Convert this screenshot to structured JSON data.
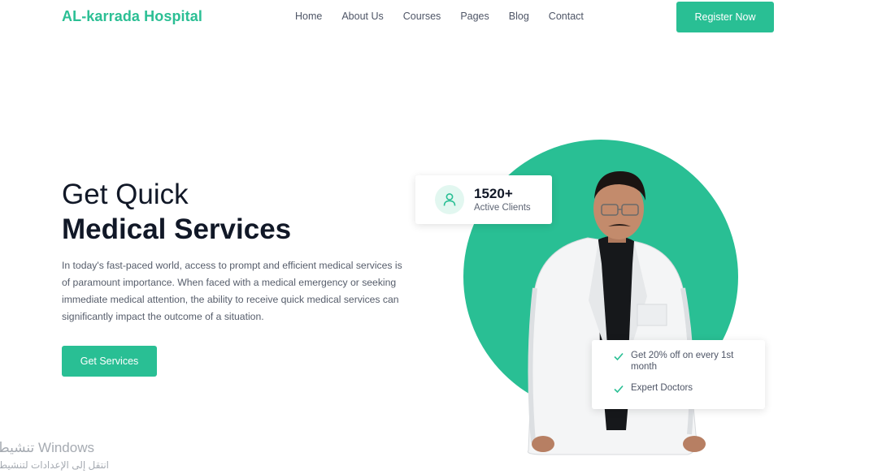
{
  "header": {
    "brand": "AL-karrada Hospital",
    "nav": [
      "Home",
      "About Us",
      "Courses",
      "Pages",
      "Blog",
      "Contact"
    ],
    "register_label": "Register Now"
  },
  "hero": {
    "title_line1": "Get Quick",
    "title_line2": "Medical Services",
    "description": "In today's fast-paced world, access to prompt and efficient medical services is of paramount importance. When faced with a medical emergency or seeking immediate medical attention, the ability to receive quick medical services can significantly impact the outcome of a situation.",
    "cta_label": "Get Services"
  },
  "stats": {
    "number": "1520+",
    "label": "Active Clients",
    "icon": "user-icon"
  },
  "features": [
    {
      "text": "Get 20% off on every 1st month",
      "icon": "check-icon"
    },
    {
      "text": "Expert Doctors",
      "icon": "check-icon"
    }
  ],
  "watermark": {
    "line1": "تنشيط Windows",
    "line2": "انتقل إلى الإعدادات لتنشيط"
  },
  "colors": {
    "accent": "#29bf94",
    "brand_text": "#2bbf94",
    "heading": "#111827",
    "body_text": "#565d6b"
  }
}
